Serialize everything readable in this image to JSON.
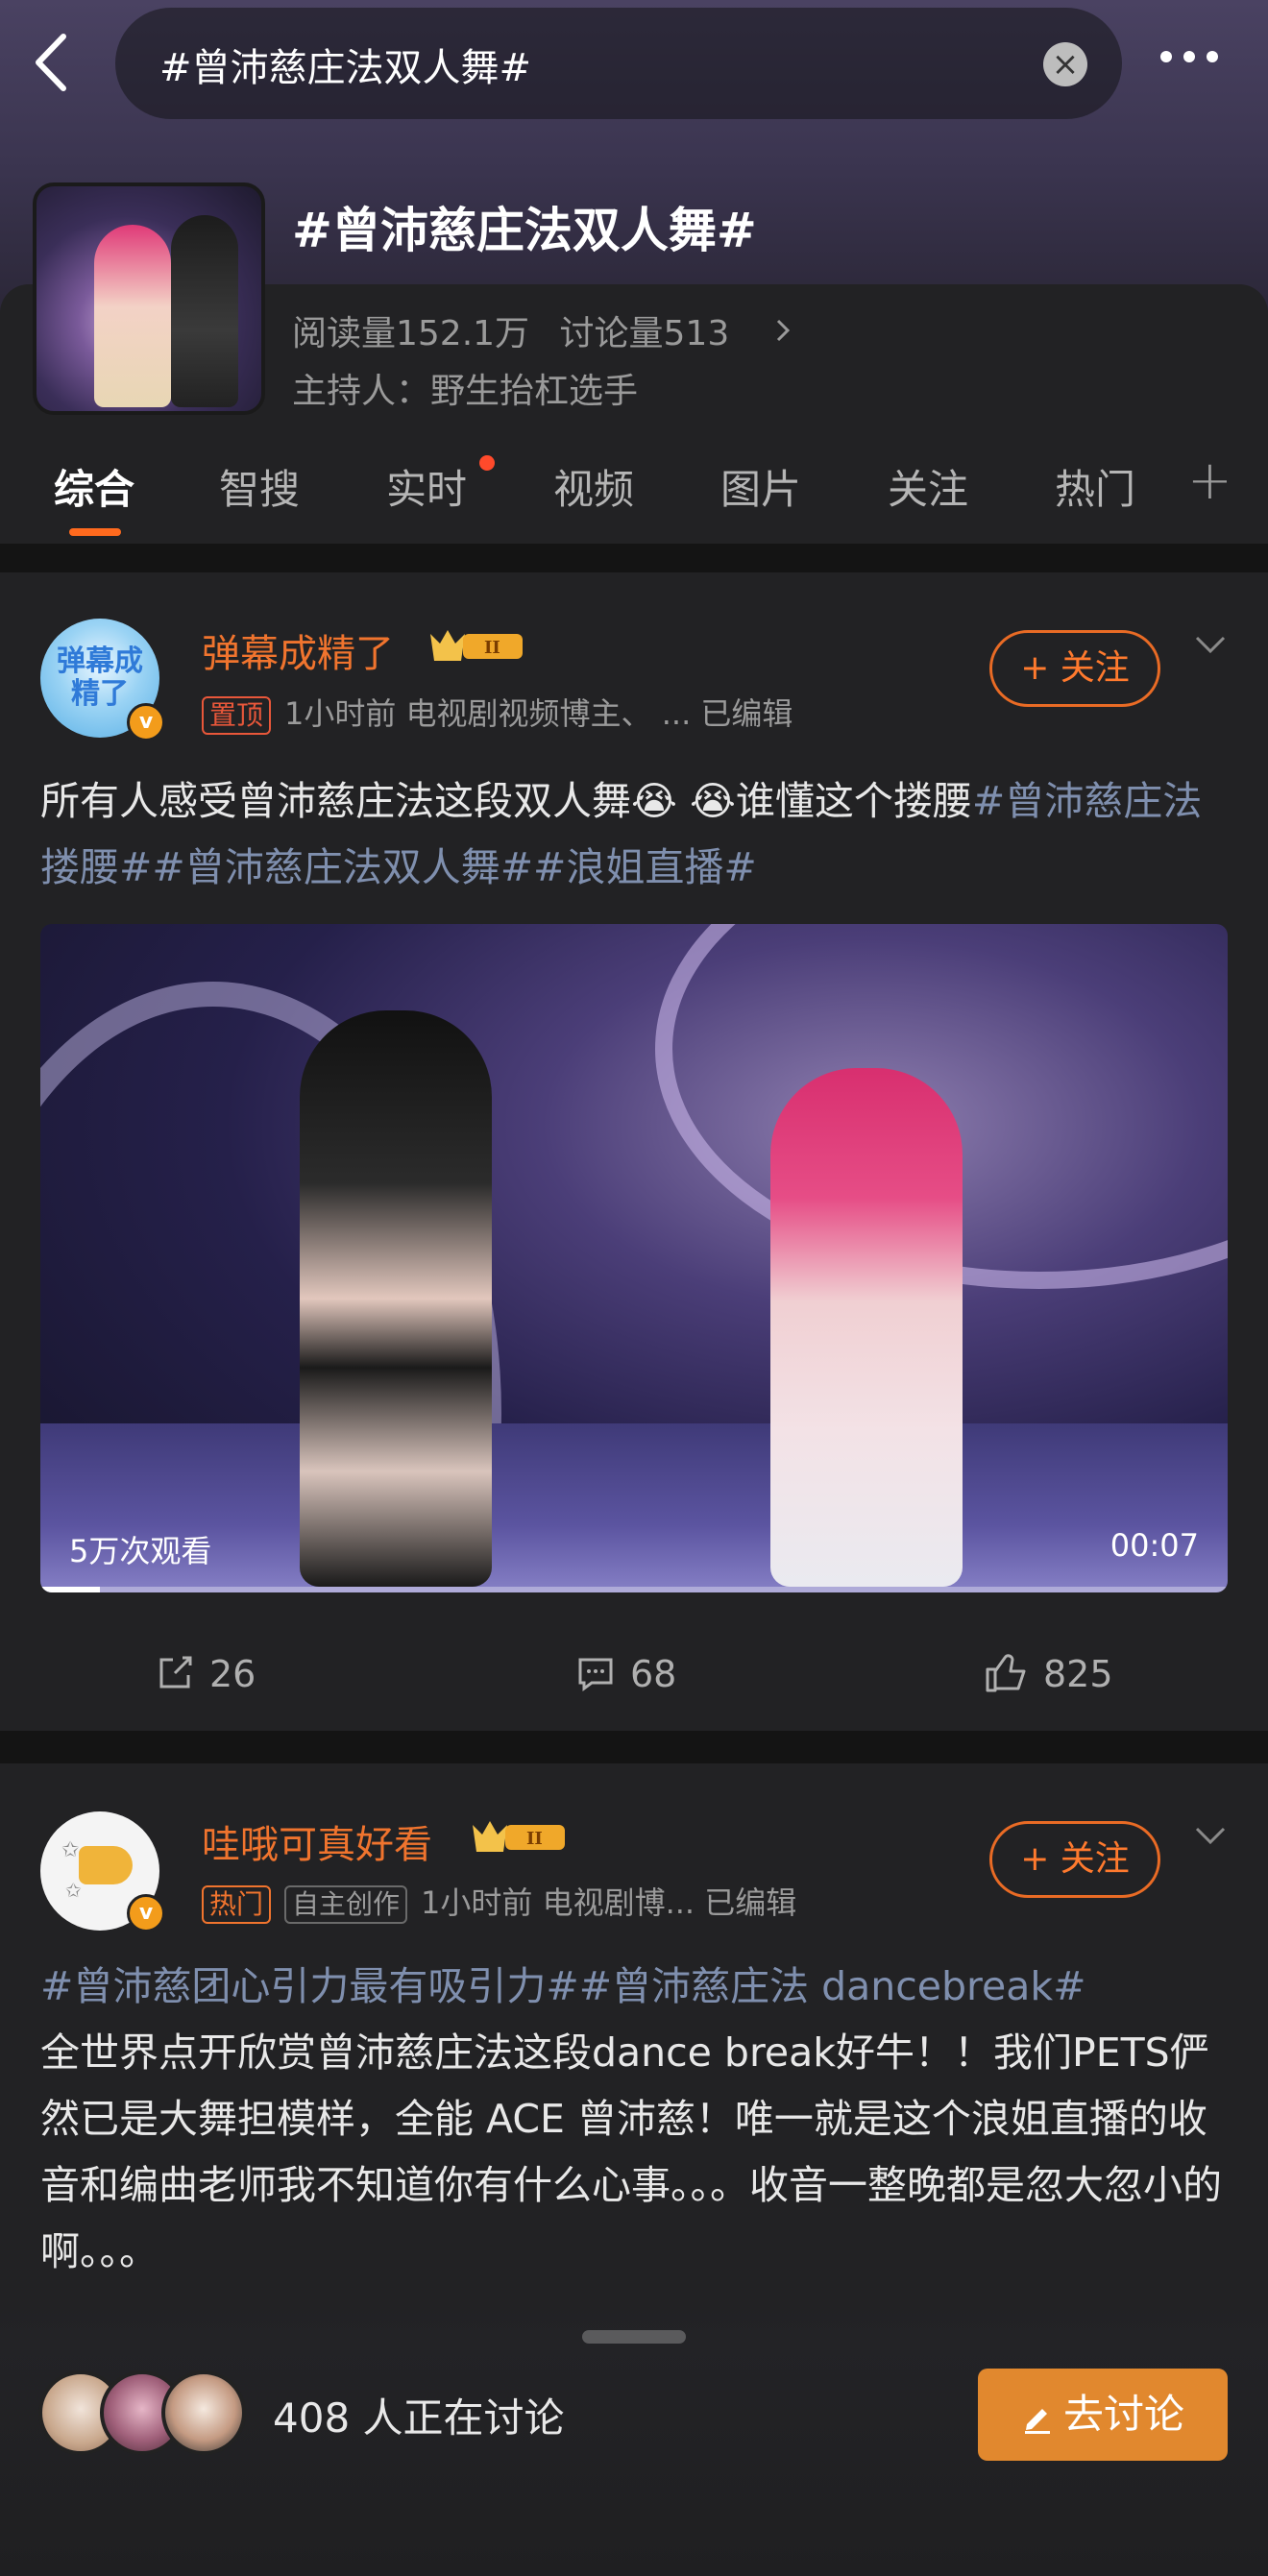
{
  "search": {
    "query": "#曾沛慈庄法双人舞#"
  },
  "topic": {
    "title": "#曾沛慈庄法双人舞#",
    "reads": "阅读量152.1万",
    "discussions": "讨论量513",
    "host": "主持人：野生抬杠选手"
  },
  "tabs": [
    {
      "label": "综合"
    },
    {
      "label": "智搜"
    },
    {
      "label": "实时"
    },
    {
      "label": "视频"
    },
    {
      "label": "图片"
    },
    {
      "label": "关注"
    },
    {
      "label": "热门"
    }
  ],
  "posts": [
    {
      "username": "弹幕成精了",
      "avatar_text": "弹幕成精了",
      "badges": [
        "置顶"
      ],
      "meta": "1小时前  电视剧视频博主、 ... 已编辑",
      "follow_label": "+ 关注",
      "text": "所有人感受曾沛慈庄法这段双人舞",
      "emoji": "😭 😭",
      "text_after_emoji": "谁懂这个搂腰",
      "hashtags": "#曾沛慈庄法搂腰##曾沛慈庄法双人舞##浪姐直播#",
      "video": {
        "views": "5万次观看",
        "duration": "00:07",
        "progress": 0.05
      },
      "reposts": "26",
      "comments": "68",
      "likes": "825"
    },
    {
      "username": "哇哦可真好看",
      "badges": [
        "热门",
        "自主创作"
      ],
      "meta": "1小时前  电视剧博... 已编辑",
      "follow_label": "+ 关注",
      "hashtags": "#曾沛慈团心引力最有吸引力##曾沛慈庄法 dancebreak#",
      "text": "全世界点开欣赏曾沛慈庄法这段dance break好牛！！我们PETS俨然已是大舞担模样，全能 ACE 曾沛慈！唯一就是这个浪姐直播的收音和编曲老师我不知道你有什么心事。。。收音一整晚都是忽大忽小的啊。。。"
    }
  ],
  "bottom": {
    "count_text": "408 人正在讨论",
    "discuss_label": "去讨论"
  },
  "colors": {
    "accent": "#f0742e",
    "hashtag": "#7f8fae",
    "discuss_button": "#e1882e",
    "tab_underline": "#ff6a1e"
  }
}
